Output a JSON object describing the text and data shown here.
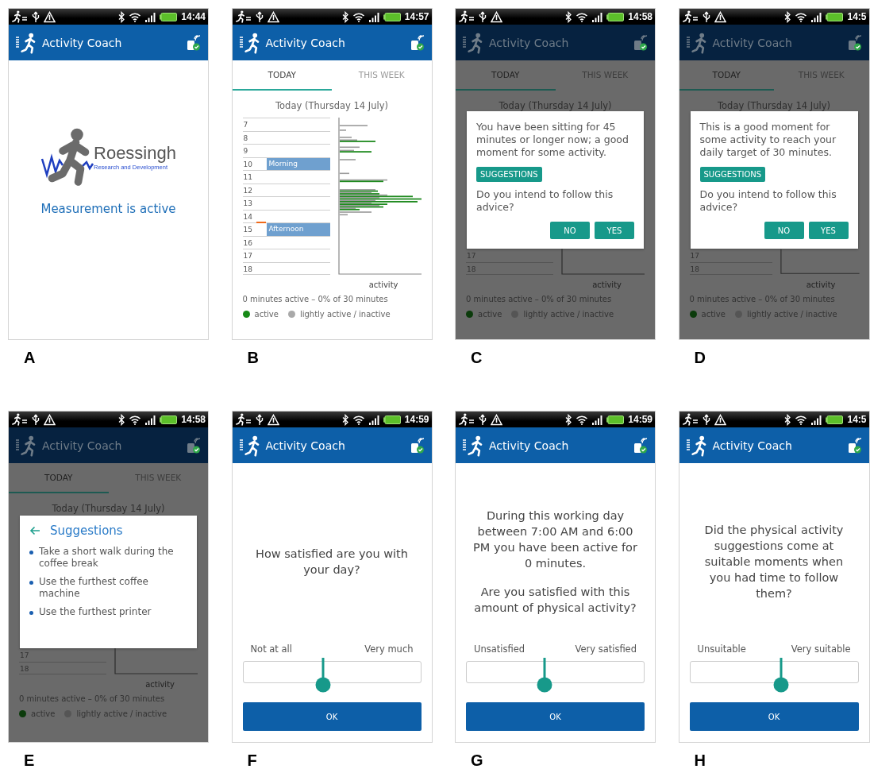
{
  "panels": [
    {
      "letter": "A",
      "time": "14:44",
      "title": "Activity Coach",
      "kind": "splash",
      "logo": {
        "name": "Roessingh",
        "tagline": "Research and Development"
      },
      "message": "Measurement is active"
    },
    {
      "letter": "B",
      "time": "14:57",
      "title": "Activity Coach",
      "kind": "today",
      "tabs": [
        {
          "label": "TODAY",
          "selected": true
        },
        {
          "label": "THIS WEEK",
          "selected": false
        }
      ],
      "date": "Today (Thursday 14 July)",
      "schedule": [
        {
          "hour": "7",
          "now": false
        },
        {
          "hour": "8",
          "now": false
        },
        {
          "hour": "9",
          "now": false
        },
        {
          "hour": "10",
          "now": false,
          "block": "Morning"
        },
        {
          "hour": "11",
          "now": false
        },
        {
          "hour": "12",
          "now": false
        },
        {
          "hour": "13",
          "now": false
        },
        {
          "hour": "14",
          "now": false
        },
        {
          "hour": "15",
          "now": true,
          "block": "Afternoon"
        },
        {
          "hour": "16",
          "now": false
        },
        {
          "hour": "17",
          "now": false
        },
        {
          "hour": "18",
          "now": false
        }
      ],
      "chart_label": "activity",
      "summary": "0 minutes active – 0% of 30 minutes",
      "legend": [
        {
          "label": "active",
          "color": "#178a17"
        },
        {
          "label": "lightly active / inactive",
          "color": "#a9a9a9"
        }
      ]
    },
    {
      "letter": "C",
      "time": "14:58",
      "title": "Activity Coach",
      "kind": "today",
      "tabs": [
        {
          "label": "TODAY",
          "selected": true
        },
        {
          "label": "THIS WEEK",
          "selected": false
        }
      ],
      "date": "Today (Thursday 14 July)",
      "dialog": {
        "kind": "prompt",
        "message": "You have been sitting for 45 minutes or longer now; a good moment for some activity.",
        "suggestions": "SUGGESTIONS",
        "question": "Do you intend to follow this advice?",
        "buttons": [
          "NO",
          "YES"
        ]
      },
      "schedule": [
        {
          "hour": "17",
          "now": false
        },
        {
          "hour": "18",
          "now": false
        }
      ],
      "chart_label": "activity",
      "summary": "0 minutes active – 0% of 30 minutes",
      "legend": [
        {
          "label": "active",
          "color": "#0b3b0b"
        },
        {
          "label": "lightly active / inactive",
          "color": "#555555"
        }
      ]
    },
    {
      "letter": "D",
      "time": "14:5",
      "title": "Activity Coach",
      "kind": "today",
      "tabs": [
        {
          "label": "TODAY",
          "selected": true
        },
        {
          "label": "THIS WEEK",
          "selected": false
        }
      ],
      "date": "Today (Thursday 14 July)",
      "dialog": {
        "kind": "prompt",
        "message": "This is a good moment for some activity to reach your daily target of 30 minutes.",
        "suggestions": "SUGGESTIONS",
        "question": "Do you intend to follow this advice?",
        "buttons": [
          "NO",
          "YES"
        ]
      },
      "schedule": [
        {
          "hour": "17",
          "now": false
        },
        {
          "hour": "18",
          "now": false
        }
      ],
      "chart_label": "activity",
      "summary": "0 minutes active – 0% of 30 minutes",
      "legend": [
        {
          "label": "active",
          "color": "#0b3b0b"
        },
        {
          "label": "lightly active / inactive",
          "color": "#555555"
        }
      ]
    },
    {
      "letter": "E",
      "time": "14:58",
      "title": "Activity Coach",
      "kind": "today",
      "tabs": [
        {
          "label": "TODAY",
          "selected": true
        },
        {
          "label": "THIS WEEK",
          "selected": false
        }
      ],
      "date": "Today (Thursday 14 July)",
      "dialog": {
        "kind": "suggestions",
        "title": "Suggestions",
        "items": [
          "Take a short walk during the coffee break",
          "Use the furthest coffee machine",
          "Use the furthest printer"
        ]
      },
      "schedule": [
        {
          "hour": "17",
          "now": false
        },
        {
          "hour": "18",
          "now": false
        }
      ],
      "chart_label": "activity",
      "summary": "0 minutes active – 0% of 30 minutes",
      "legend": [
        {
          "label": "active",
          "color": "#0b3b0b"
        },
        {
          "label": "lightly active / inactive",
          "color": "#555555"
        }
      ]
    },
    {
      "letter": "F",
      "time": "14:59",
      "title": "Activity Coach",
      "kind": "question",
      "paragraphs": [
        "How satisfied are you with your day?"
      ],
      "slider": {
        "min_label": "Not at all",
        "max_label": "Very much",
        "level": 0.45
      },
      "button": "OK"
    },
    {
      "letter": "G",
      "time": "14:59",
      "title": "Activity Coach",
      "kind": "question",
      "paragraphs": [
        "During this working day between 7:00 AM and 6:00 PM you have been active for 0 minutes.",
        "Are you satisfied with this amount of physical activity?"
      ],
      "slider": {
        "min_label": "Unsatisfied",
        "max_label": "Very satisfied",
        "level": 0.44
      },
      "button": "OK"
    },
    {
      "letter": "H",
      "time": "14:5",
      "title": "Activity Coach",
      "kind": "question",
      "paragraphs": [
        "Did the physical activity suggestions come at suitable moments when you had time to follow them?"
      ],
      "slider": {
        "min_label": "Unsuitable",
        "max_label": "Very suitable",
        "level": 0.54
      },
      "button": "OK"
    }
  ]
}
